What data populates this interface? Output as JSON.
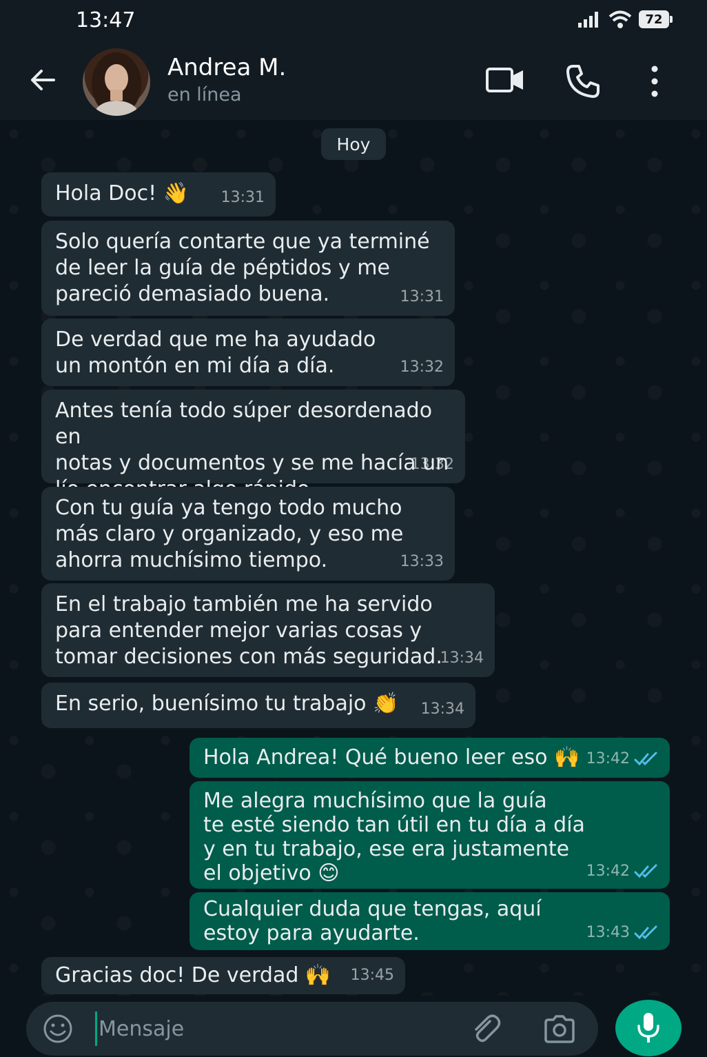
{
  "status_bar": {
    "time": "13:47",
    "battery": "72"
  },
  "header": {
    "contact_name": "Andrea M.",
    "contact_status": "en línea"
  },
  "chat": {
    "date_chip": "Hoy",
    "messages": [
      {
        "direction": "in",
        "text": "Hola Doc! 👋",
        "time": "13:31"
      },
      {
        "direction": "in",
        "text": "Solo quería contarte que ya terminé\nde leer la guía de péptidos y me\npareció demasiado buena.",
        "time": "13:31"
      },
      {
        "direction": "in",
        "text": "De verdad que me ha ayudado\nun montón en mi día a día.",
        "time": "13:32"
      },
      {
        "direction": "in",
        "text": "Antes tenía todo súper desordenado en\nnotas y documentos y se me hacía un\nlío encontrar algo rápido.",
        "time": "13:32"
      },
      {
        "direction": "in",
        "text": "Con tu guía ya tengo todo mucho\nmás claro y organizado, y eso me\nahorra muchísimo tiempo.",
        "time": "13:33"
      },
      {
        "direction": "in",
        "text": "En el trabajo también me ha servido\npara entender mejor varias cosas y\ntomar decisiones con más seguridad.",
        "time": "13:34"
      },
      {
        "direction": "in",
        "text": "En serio, buenísimo tu trabajo 👏",
        "time": "13:34"
      },
      {
        "direction": "out",
        "text": "Hola Andrea! Qué bueno leer eso 🙌",
        "time": "13:42",
        "status": "read"
      },
      {
        "direction": "out",
        "text": "Me alegra muchísimo que la guía\nte esté siendo tan útil en tu día a día\ny en tu trabajo, ese era justamente\nel objetivo 😊",
        "time": "13:42",
        "status": "read"
      },
      {
        "direction": "out",
        "text": "Cualquier duda que tengas, aquí\nestoy para ayudarte.",
        "time": "13:43",
        "status": "read"
      },
      {
        "direction": "in",
        "text": "Gracias doc! De verdad 🙌",
        "time": "13:45"
      }
    ]
  },
  "composer": {
    "placeholder": "Mensaje"
  },
  "icons": {
    "back": "arrow-left-icon",
    "video": "video-camera-icon",
    "phone": "phone-icon",
    "menu": "more-vertical-icon",
    "emoji": "emoji-icon",
    "attach": "paperclip-icon",
    "camera": "camera-icon",
    "mic": "microphone-icon",
    "read_receipt": "double-check-icon"
  },
  "colors": {
    "background": "#0b141a",
    "header": "#121b22",
    "incoming_bubble": "#202c33",
    "outgoing_bubble": "#005c4b",
    "accent": "#00a884",
    "read_tick": "#53bdeb"
  }
}
